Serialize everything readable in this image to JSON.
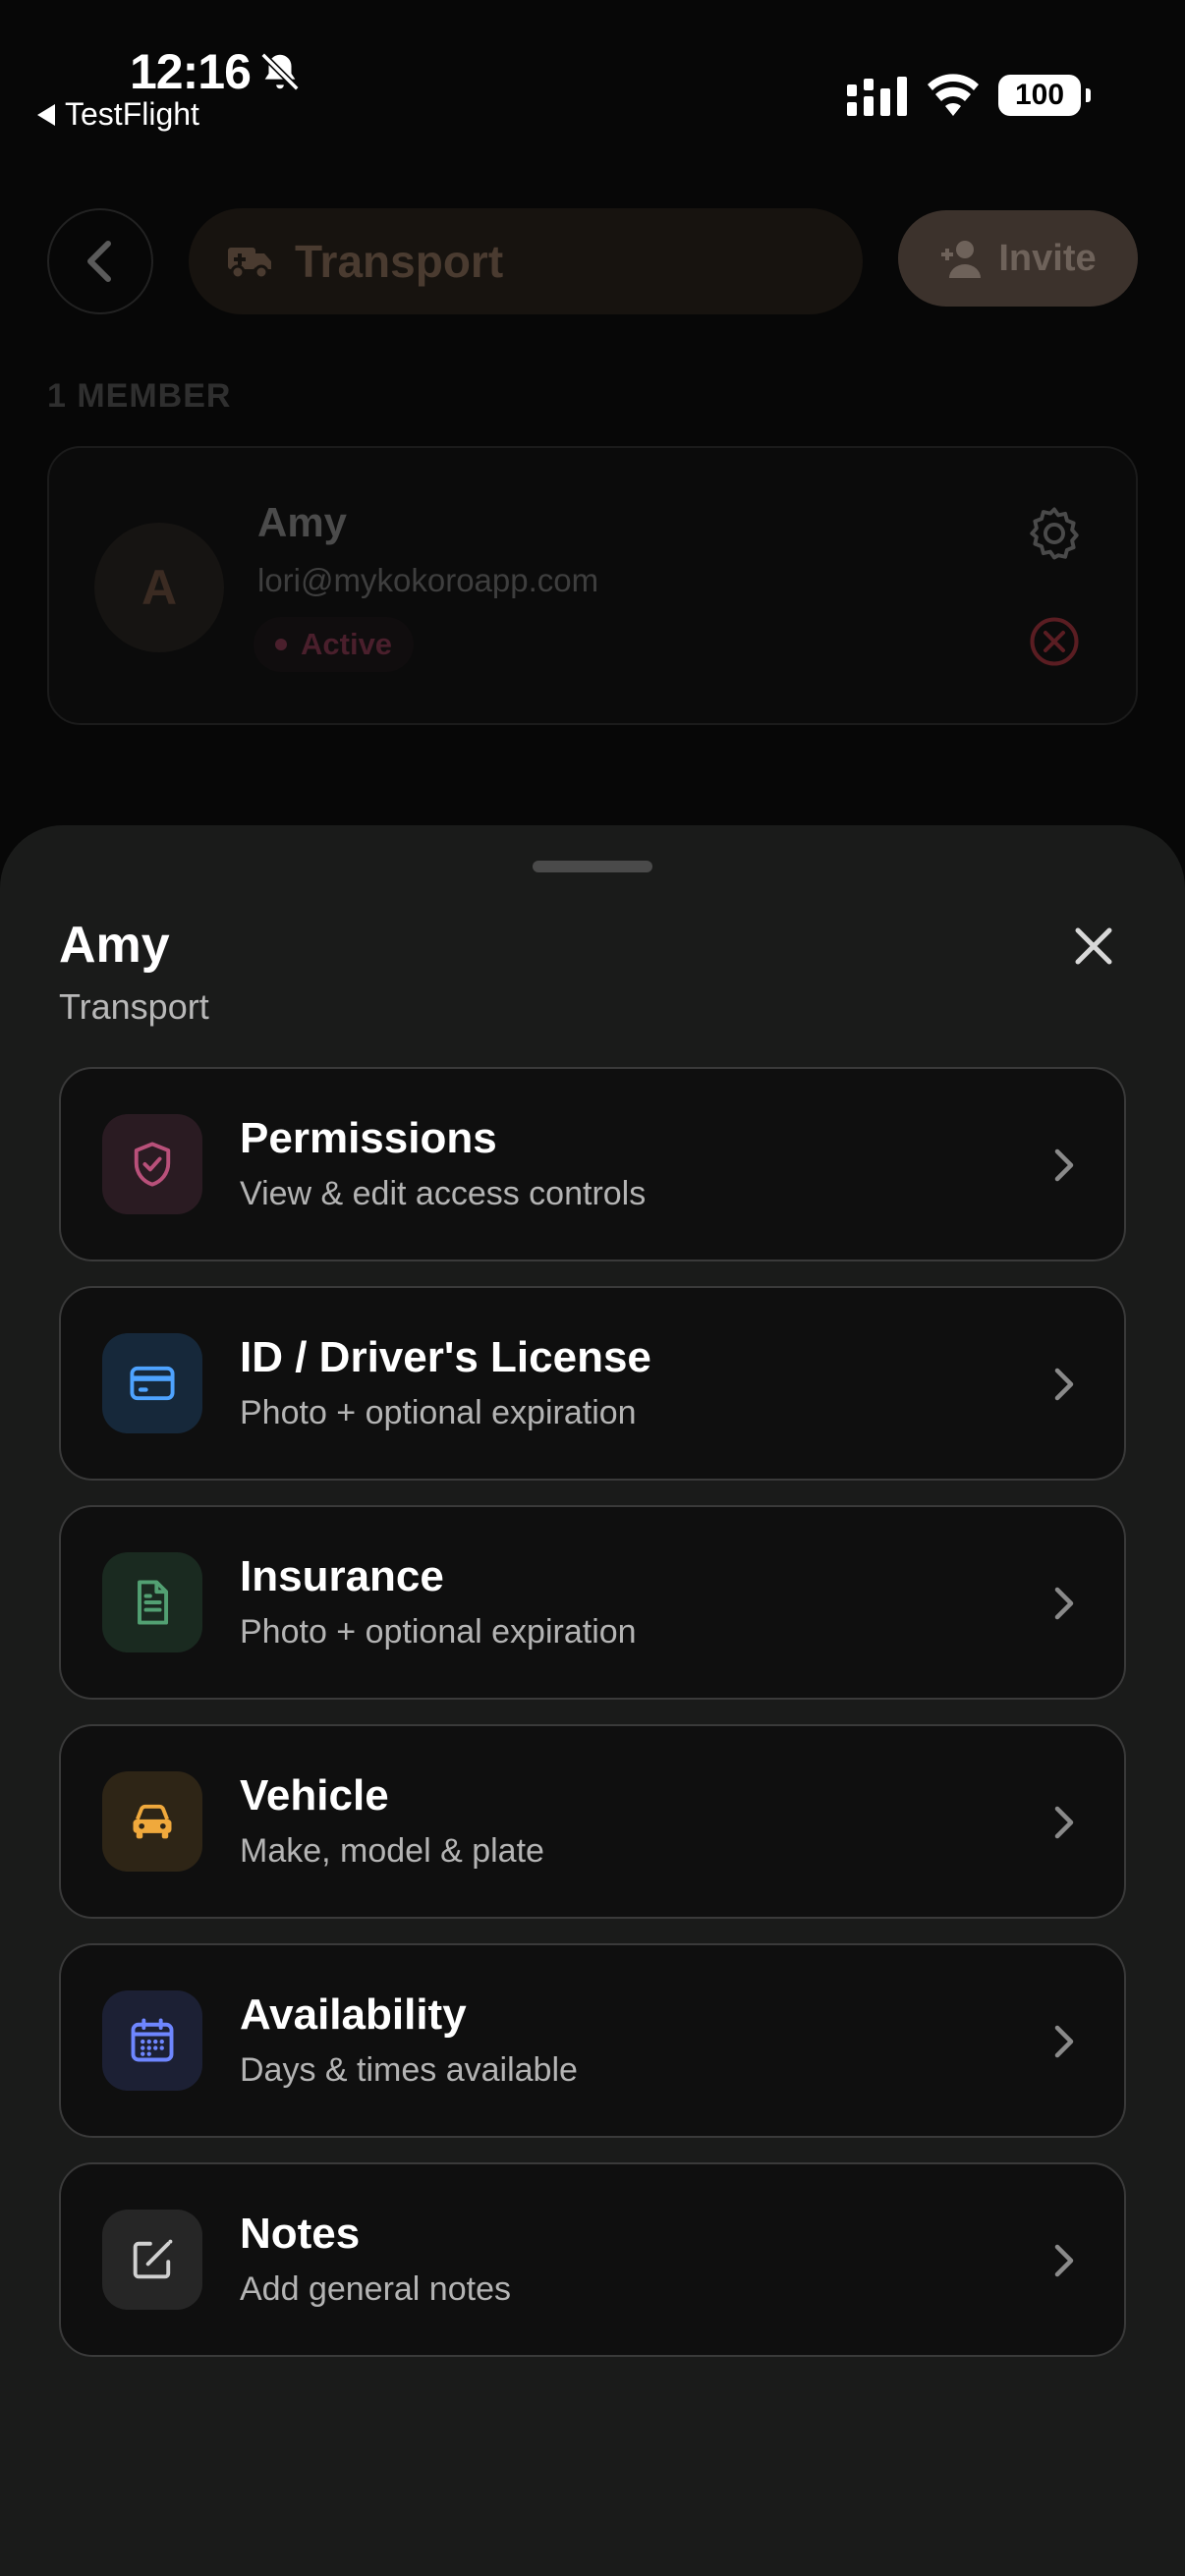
{
  "status_bar": {
    "time": "12:16",
    "back_app": "TestFlight",
    "battery": "100"
  },
  "background_page": {
    "group_name": "Transport",
    "invite_label": "Invite",
    "member_count": "1 MEMBER",
    "member": {
      "avatar_initial": "A",
      "name": "Amy",
      "email": "lori@mykokoroapp.com",
      "status": "Active"
    }
  },
  "sheet": {
    "title": "Amy",
    "subtitle": "Transport",
    "options": [
      {
        "title": "Permissions",
        "desc": "View & edit access controls",
        "icon": "shield-check-icon",
        "tint": "#2a1b22",
        "color": "#b9507a"
      },
      {
        "title": "ID / Driver's License",
        "desc": "Photo + optional expiration",
        "icon": "id-card-icon",
        "tint": "#16283a",
        "color": "#4ea3ff"
      },
      {
        "title": "Insurance",
        "desc": "Photo + optional expiration",
        "icon": "document-icon",
        "tint": "#1a2a20",
        "color": "#52a072"
      },
      {
        "title": "Vehicle",
        "desc": "Make, model & plate",
        "icon": "car-icon",
        "tint": "#2e2516",
        "color": "#f0a93c"
      },
      {
        "title": "Availability",
        "desc": "Days & times available",
        "icon": "calendar-icon",
        "tint": "#1c2034",
        "color": "#6e86ff"
      },
      {
        "title": "Notes",
        "desc": "Add general notes",
        "icon": "edit-note-icon",
        "tint": "#262626",
        "color": "#d0d0d0"
      }
    ]
  }
}
